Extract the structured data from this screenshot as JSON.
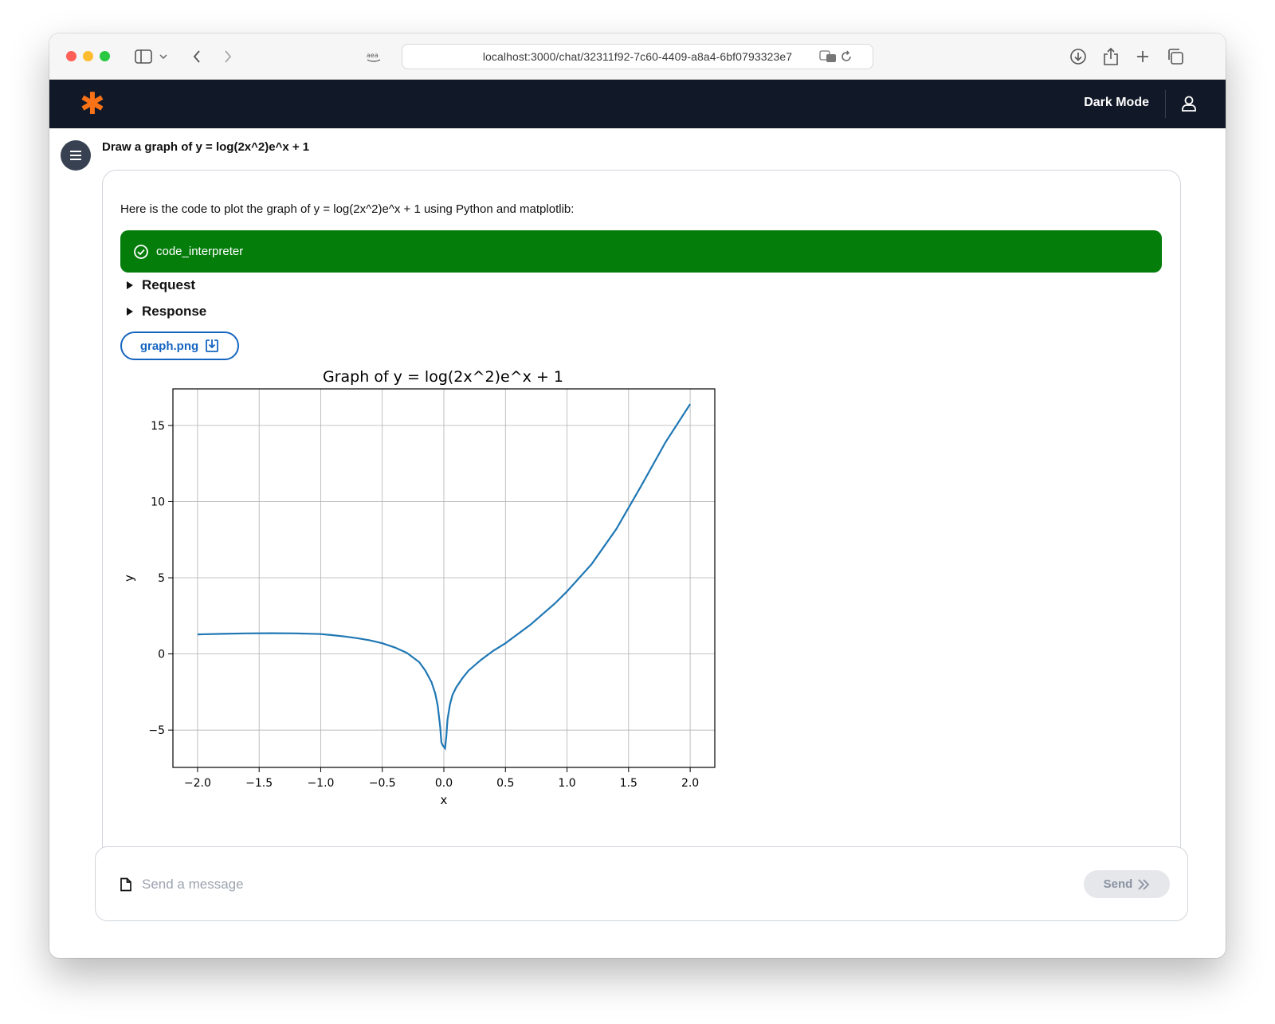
{
  "browser": {
    "url": "localhost:3000/chat/32311f92-7c60-4409-a8a4-6bf0793323e7",
    "icons": [
      "sidebar-icon",
      "chevron-down-icon",
      "back-icon",
      "forward-icon",
      "amazon-extension-icon",
      "translate-icon",
      "reload-icon",
      "download-icon",
      "share-icon",
      "new-tab-icon",
      "tab-overview-icon"
    ]
  },
  "header": {
    "logo": "✱",
    "dark_mode_label": "Dark Mode",
    "logo_color": "#f97316",
    "background": "#111827"
  },
  "chat": {
    "user_message": "Draw a graph of y = log(2x^2)e^x + 1",
    "assistant": {
      "intro": "Here is the code to plot the graph of y = log(2x^2)e^x + 1 using Python and matplotlib:",
      "tool_name": "code_interpreter",
      "tool_color": "#047d0b",
      "request_label": "Request",
      "response_label": "Response",
      "file_name": "graph.png"
    }
  },
  "composer": {
    "placeholder": "Send a message",
    "send_label": "Send"
  },
  "chart_data": {
    "type": "line",
    "title": "Graph of y = log(2x^2)e^x + 1",
    "xlabel": "x",
    "ylabel": "y",
    "xlim": [
      -2.2,
      2.2
    ],
    "ylim": [
      -7.45,
      17.4
    ],
    "xticks": [
      -2.0,
      -1.5,
      -1.0,
      -0.5,
      0.0,
      0.5,
      1.0,
      1.5,
      2.0
    ],
    "xtick_labels": [
      "−2.0",
      "−1.5",
      "−1.0",
      "−0.5",
      "0.0",
      "0.5",
      "1.0",
      "1.5",
      "2.0"
    ],
    "yticks": [
      -5,
      0,
      5,
      10,
      15
    ],
    "ytick_labels": [
      "−5",
      "0",
      "5",
      "10",
      "15"
    ],
    "grid": true,
    "line_color": "#1f77b4",
    "series": [
      {
        "x": [
          -2.0,
          -1.8,
          -1.6,
          -1.4,
          -1.2,
          -1.0,
          -0.9,
          -0.8,
          -0.7,
          -0.6,
          -0.5,
          -0.4,
          -0.3,
          -0.2,
          -0.15,
          -0.1,
          -0.07,
          -0.05,
          -0.03,
          -0.02,
          -0.01,
          0.01,
          0.02,
          0.03,
          0.05,
          0.07,
          0.1,
          0.15,
          0.2,
          0.3,
          0.4,
          0.5,
          0.6,
          0.7,
          0.8,
          0.9,
          1.0,
          1.2,
          1.4,
          1.6,
          1.8,
          2.0
        ],
        "y": [
          1.28,
          1.32,
          1.35,
          1.36,
          1.35,
          1.3,
          1.23,
          1.14,
          1.03,
          0.89,
          0.7,
          0.43,
          0.07,
          -0.54,
          -1.1,
          -1.85,
          -2.6,
          -3.4,
          -4.8,
          -5.8,
          -6.0,
          -6.2,
          -5.4,
          -4.3,
          -3.3,
          -2.7,
          -2.2,
          -1.6,
          -1.1,
          -0.4,
          0.2,
          0.7,
          1.3,
          1.9,
          2.6,
          3.3,
          4.1,
          5.9,
          8.2,
          11.0,
          13.9,
          16.4
        ]
      }
    ]
  }
}
